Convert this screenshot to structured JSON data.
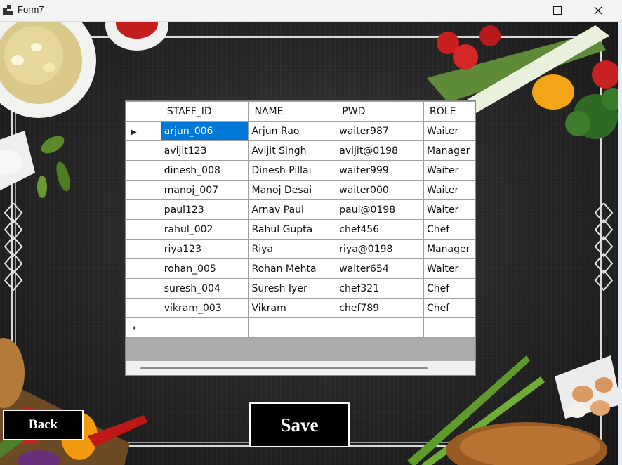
{
  "window": {
    "title": "Form7",
    "minimize_glyph": "—",
    "maximize_glyph": "☐",
    "close_glyph": "✕"
  },
  "grid": {
    "columns": [
      "STAFF_ID",
      "NAME",
      "PWD",
      "ROLE"
    ],
    "current_row_glyph": "▶",
    "new_row_glyph": "*",
    "rows": [
      [
        "arjun_006",
        "Arjun Rao",
        "waiter987",
        "Waiter"
      ],
      [
        "avijit123",
        "Avijit Singh",
        "avijit@0198",
        "Manager"
      ],
      [
        "dinesh_008",
        "Dinesh Pillai",
        "waiter999",
        "Waiter"
      ],
      [
        "manoj_007",
        "Manoj Desai",
        "waiter000",
        "Waiter"
      ],
      [
        "paul123",
        "Arnav Paul",
        "paul@0198",
        "Waiter"
      ],
      [
        "rahul_002",
        "Rahul Gupta",
        "chef456",
        "Chef"
      ],
      [
        "riya123",
        "Riya",
        "riya@0198",
        "Manager"
      ],
      [
        "rohan_005",
        "Rohan Mehta",
        "waiter654",
        "Waiter"
      ],
      [
        "suresh_004",
        "Suresh Iyer",
        "chef321",
        "Chef"
      ],
      [
        "vikram_003",
        "Vikram",
        "chef789",
        "Chef"
      ]
    ]
  },
  "buttons": {
    "back": "Back",
    "save": "Save"
  },
  "icons": {
    "app": "form-app-icon",
    "minimize": "minimize-icon",
    "maximize": "maximize-icon",
    "close": "close-icon",
    "current_row": "row-indicator-icon",
    "new_row": "new-row-icon"
  },
  "colors": {
    "selection": "#0078d7",
    "background": "#262626",
    "button": "#000000",
    "frame": "#d9d9d9"
  }
}
